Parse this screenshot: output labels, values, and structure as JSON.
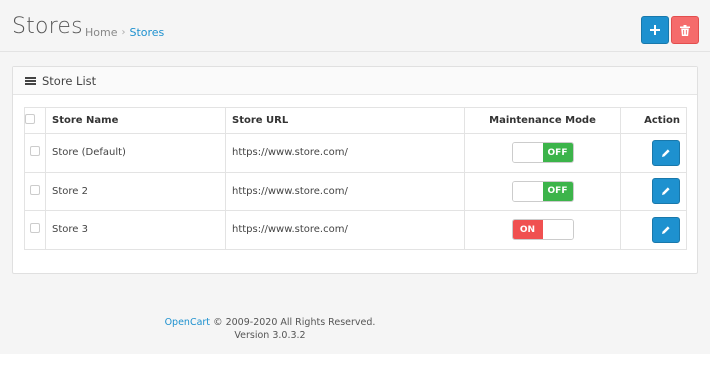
{
  "header": {
    "title": "Stores",
    "breadcrumb": [
      {
        "label": "Home"
      },
      {
        "label": "Stores"
      }
    ],
    "breadcrumb_separator": "›",
    "add_icon": "plus-icon",
    "delete_icon": "trash-icon"
  },
  "panel": {
    "title": "Store List",
    "icon": "list-icon"
  },
  "table": {
    "columns": [
      "Store Name",
      "Store URL",
      "Maintenance Mode",
      "Action"
    ],
    "rows": [
      {
        "name": "Store (Default)",
        "url": "https://www.store.com/",
        "mode": "OFF"
      },
      {
        "name": "Store 2",
        "url": "https://www.store.com/",
        "mode": "OFF"
      },
      {
        "name": "Store 3",
        "url": "https://www.store.com/",
        "mode": "ON"
      }
    ],
    "action_icon": "pencil-icon"
  },
  "footer": {
    "brand": "OpenCart",
    "copyright": " © 2009-2020 All Rights Reserved.",
    "version": "Version 3.0.3.2"
  },
  "colors": {
    "primary": "#1e91cf",
    "danger": "#f56b6b",
    "toggle_off": "#3cb44a",
    "toggle_on": "#f05050"
  }
}
